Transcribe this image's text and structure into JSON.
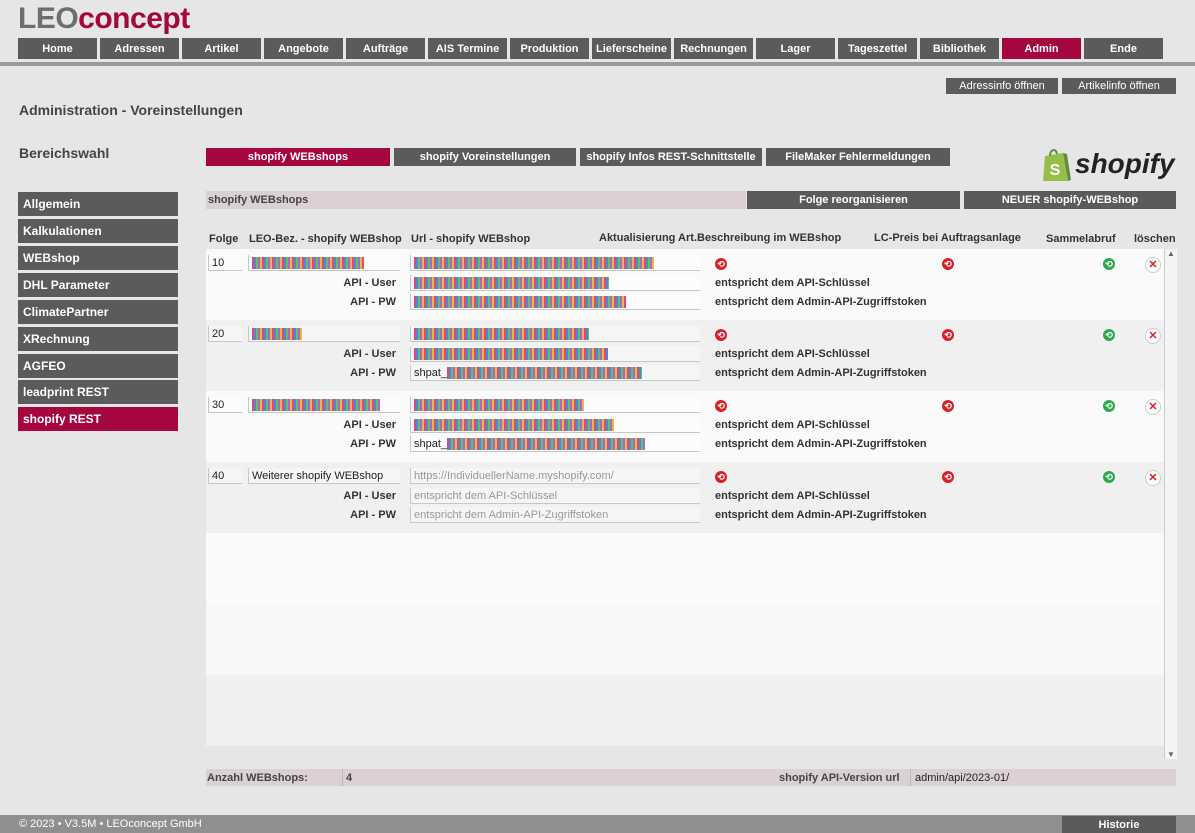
{
  "brand": {
    "part1": "LEO",
    "part2": "concept"
  },
  "nav": [
    "Home",
    "Adressen",
    "Artikel",
    "Angebote",
    "Aufträge",
    "AIS Termine",
    "Produktion",
    "Lieferscheine",
    "Rechnungen",
    "Lager",
    "Tageszettel",
    "Bibliothek",
    "Admin",
    "Ende"
  ],
  "nav_active": "Admin",
  "top_buttons": {
    "address_info": "Adressinfo öffnen",
    "article_info": "Artikelinfo öffnen"
  },
  "page_title": "Administration - Voreinstellungen",
  "sidebar": {
    "heading": "Bereichswahl",
    "items": [
      "Allgemein",
      "Kalkulationen",
      "WEBshop",
      "DHL Parameter",
      "ClimatePartner",
      "XRechnung",
      "AGFEO",
      "leadprint REST",
      "shopify REST"
    ],
    "active": "shopify REST"
  },
  "tabs": [
    "shopify WEBshops",
    "shopify Voreinstellungen",
    "shopify Infos REST-Schnittstelle",
    "FileMaker Fehlermeldungen"
  ],
  "tab_active": "shopify WEBshops",
  "shopify_logo_text": "shopify",
  "section": {
    "title": "shopify WEBshops",
    "reorg_button": "Folge reorganisieren",
    "new_button": "NEUER shopify-WEBshop"
  },
  "columns": {
    "folge": "Folge",
    "leo_bez": "LEO-Bez. - shopify WEBshop",
    "url": "Url - shopify WEBshop",
    "aktualisierung": "Aktualisierung Art.Beschreibung im WEBshop",
    "lc_preis": "LC-Preis bei Auftragsanlage",
    "sammelabruf": "Sammelabruf",
    "loeschen": "löschen"
  },
  "row_labels": {
    "api_user": "API - User",
    "api_pw": "API - PW",
    "api_user_info": "entspricht dem API-Schlüssel",
    "api_pw_info": "entspricht dem Admin-API-Zugriffstoken"
  },
  "rows": [
    {
      "folge": "10",
      "name": "",
      "url": "",
      "api_user": "",
      "api_pw": "",
      "pw_prefix": ""
    },
    {
      "folge": "20",
      "name": "",
      "url": "",
      "api_user": "",
      "api_pw": "",
      "pw_prefix": "shpat_"
    },
    {
      "folge": "30",
      "name": "",
      "url": "",
      "api_user": "",
      "api_pw": "",
      "pw_prefix": "shpat_"
    },
    {
      "folge": "40",
      "name": "Weiterer shopify WEBshop",
      "url_placeholder": "https://IndividuellerName.myshopify.com/",
      "api_user_placeholder": "entspricht dem API-Schlüssel",
      "api_pw_placeholder": "entspricht dem Admin-API-Zugriffstoken"
    }
  ],
  "summary": {
    "count_label": "Anzahl WEBshops:",
    "count": "4",
    "api_version_label": "shopify API-Version url",
    "api_version": "admin/api/2023-01/"
  },
  "footer": {
    "copyright": "© 2023 • V3.5M • LEOconcept GmbH",
    "history_button": "Historie"
  },
  "colors": {
    "accent": "#a6063f",
    "button": "#5b5b5b",
    "bar": "#ddd0d4"
  }
}
